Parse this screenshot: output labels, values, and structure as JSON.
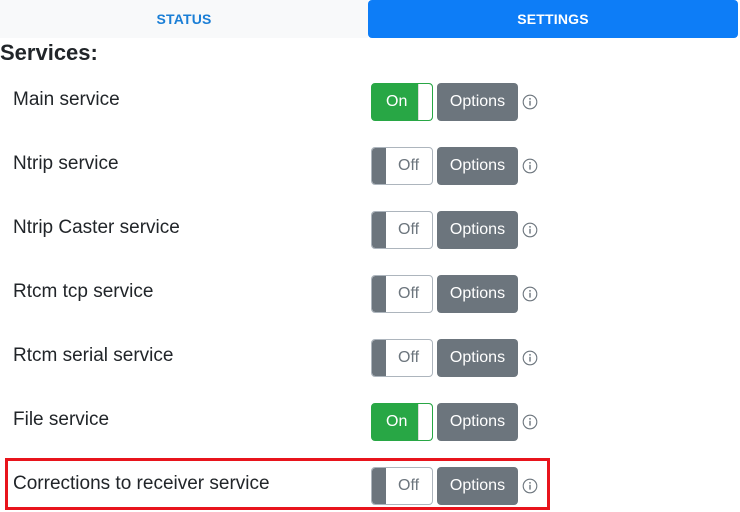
{
  "tabs": [
    {
      "label": "STATUS",
      "active": false
    },
    {
      "label": "SETTINGS",
      "active": true
    }
  ],
  "section_title": "Services:",
  "services": [
    {
      "label": "Main service",
      "state": "On",
      "options_label": "Options"
    },
    {
      "label": "Ntrip service",
      "state": "Off",
      "options_label": "Options"
    },
    {
      "label": "Ntrip Caster service",
      "state": "Off",
      "options_label": "Options"
    },
    {
      "label": "Rtcm tcp service",
      "state": "Off",
      "options_label": "Options"
    },
    {
      "label": "Rtcm serial service",
      "state": "Off",
      "options_label": "Options"
    },
    {
      "label": "File service",
      "state": "On",
      "options_label": "Options"
    },
    {
      "label": "Corrections to receiver service",
      "state": "Off",
      "options_label": "Options"
    }
  ],
  "highlighted_service_index": 6,
  "colors": {
    "tab_active_bg": "#0d7df7",
    "tab_inactive_text": "#1a7ed6",
    "toggle_on": "#28a745",
    "options_button": "#6c757d",
    "highlight_border": "#e8141c"
  },
  "icons": {
    "info": "info-circle-icon"
  }
}
